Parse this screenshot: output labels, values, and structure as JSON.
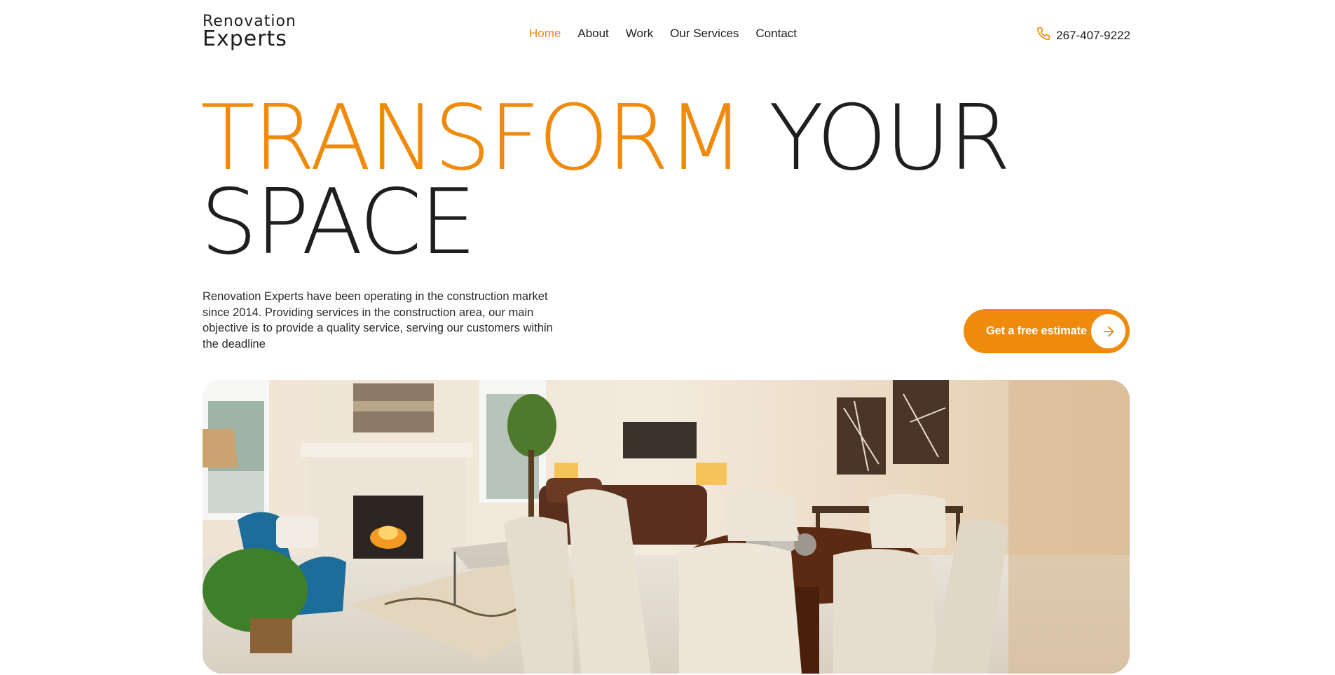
{
  "brand": {
    "line1": "Renovation",
    "line2": "Experts"
  },
  "nav": {
    "items": [
      {
        "label": "Home"
      },
      {
        "label": "About"
      },
      {
        "label": "Work"
      },
      {
        "label": "Our Services"
      },
      {
        "label": "Contact"
      }
    ]
  },
  "phone": {
    "number": "267-407-9222",
    "icon": "phone-icon"
  },
  "hero": {
    "title_accent": "TRANSFORM",
    "title_rest_line1": "YOUR",
    "title_line2": "SPACE",
    "description": "Renovation Experts have been operating in the construction market since 2014. Providing services in the construction area, our main objective is to provide a quality service, serving our customers within the deadline",
    "cta_label": "Get a free estimate",
    "cta_icon": "arrow-right-icon"
  },
  "colors": {
    "accent": "#f08a0a",
    "text": "#1e1e1e",
    "background": "#ffffff"
  }
}
